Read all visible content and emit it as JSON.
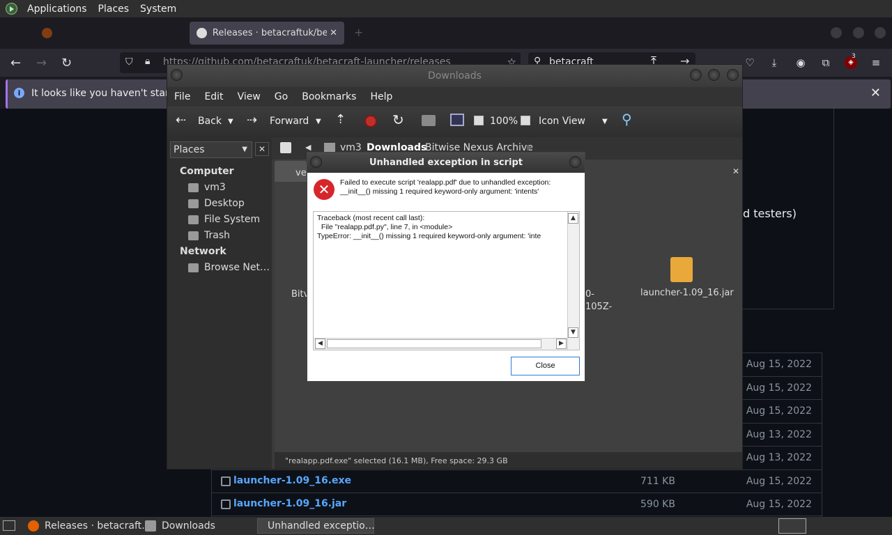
{
  "top_panel": {
    "menus": [
      "Applications",
      "Places",
      "System"
    ]
  },
  "firefox": {
    "tab_active": "Releases · betacraftuk/beta",
    "url": "https://github.com/betacraftuk/betacraft-launcher/releases",
    "search_value": "betacraft",
    "infobar_text": "It looks like you haven't started Fi",
    "badge_count": "3"
  },
  "github": {
    "partial_text": "d testers)",
    "rows": [
      {
        "name": "",
        "size": "",
        "date": "Aug 15, 2022"
      },
      {
        "name": "",
        "size": "",
        "date": "Aug 15, 2022"
      },
      {
        "name": "",
        "size": "",
        "date": "Aug 15, 2022"
      },
      {
        "name": "",
        "size": "",
        "date": "Aug 13, 2022"
      },
      {
        "name": "",
        "size": "",
        "date": "Aug 13, 2022"
      },
      {
        "name": "launcher-1.09_16.exe",
        "size": "711 KB",
        "date": "Aug 15, 2022"
      },
      {
        "name": "launcher-1.09_16.jar",
        "size": "590 KB",
        "date": "Aug 15, 2022"
      }
    ]
  },
  "file_manager": {
    "title": "Downloads",
    "menus": [
      "File",
      "Edit",
      "View",
      "Go",
      "Bookmarks",
      "Help"
    ],
    "toolbar": {
      "back": "Back",
      "forward": "Forward",
      "zoom": "100%",
      "view_mode": "Icon View"
    },
    "location": {
      "crumbs": [
        "vm3",
        "Downloads",
        "Bitwise Nexus Archive"
      ]
    },
    "sidebar": {
      "combo": "Places",
      "computer_head": "Computer",
      "computer_items": [
        "vm3",
        "Desktop",
        "File System",
        "Trash"
      ],
      "network_head": "Network",
      "network_items": [
        "Browse Net…"
      ]
    },
    "tab_partial": "ve",
    "files": {
      "partial_left": "Bitv",
      "partial_mid_1": "0-",
      "partial_mid_2": "105Z-",
      "jar_name": "launcher-1.09_16.jar"
    },
    "status": "\"realapp.pdf.exe\" selected (16.1 MB), Free space: 29.3 GB"
  },
  "dialog": {
    "title": "Unhandled exception in script",
    "message": "Failed to execute script 'realapp.pdf' due to unhandled exception: __init__() missing 1 required keyword-only argument: 'intents'",
    "traceback": "Traceback (most recent call last):\n  File \"realapp.pdf.py\", line 7, in <module>\nTypeError: __init__() missing 1 required keyword-only argument: 'inte",
    "close_label": "Close"
  },
  "taskbar": {
    "tasks": [
      "Releases · betacraft…",
      "Downloads",
      "Unhandled exceptio…"
    ]
  }
}
